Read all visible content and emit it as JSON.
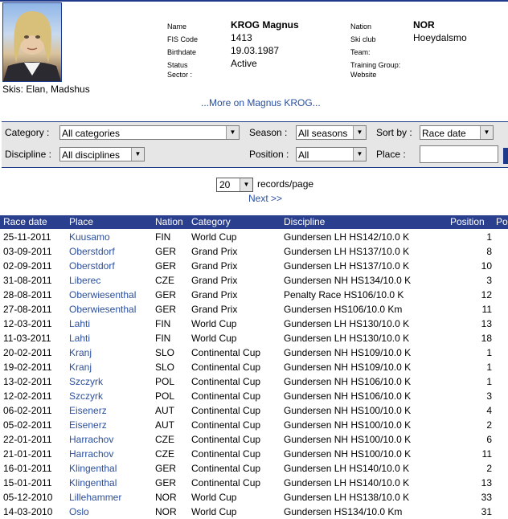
{
  "athlete": {
    "name_label": "Name",
    "name": "KROG Magnus",
    "fiscode_label": "FIS Code",
    "fiscode": "1413",
    "birthdate_label": "Birthdate",
    "birthdate": "19.03.1987",
    "status_label": "Status",
    "status": "Active",
    "sector_label": "Sector :",
    "nation_label": "Nation",
    "nation": "NOR",
    "skiclub_label": "Ski club",
    "skiclub": "Hoeydalsmo",
    "team_label": "Team:",
    "training_label": "Training Group:",
    "website_label": "Website",
    "skis": "Skis: Elan, Madshus",
    "more_link": "...More on Magnus KROG..."
  },
  "filters": {
    "category_label": "Category :",
    "category_value": "All categories",
    "discipline_label": "Discipline :",
    "discipline_value": "All disciplines",
    "season_label": "Season :",
    "season_value": "All seasons",
    "position_label": "Position :",
    "position_value": "All",
    "sortby_label": "Sort by :",
    "sortby_value": "Race date",
    "place_label": "Place :"
  },
  "paging": {
    "records_value": "20",
    "records_label": "records/page",
    "next": "Next >>"
  },
  "table": {
    "headers": [
      "Race date",
      "Place",
      "Nation",
      "Category",
      "Discipline",
      "Position",
      "Po"
    ],
    "rows": [
      {
        "date": "25-11-2011",
        "place": "Kuusamo",
        "nation": "FIN",
        "category": "World Cup",
        "discipline": "Gundersen LH HS142/10.0 K",
        "position": "1"
      },
      {
        "date": "03-09-2011",
        "place": "Oberstdorf",
        "nation": "GER",
        "category": "Grand Prix",
        "discipline": "Gundersen LH HS137/10.0 K",
        "position": "8"
      },
      {
        "date": "02-09-2011",
        "place": "Oberstdorf",
        "nation": "GER",
        "category": "Grand Prix",
        "discipline": "Gundersen LH HS137/10.0 K",
        "position": "10"
      },
      {
        "date": "31-08-2011",
        "place": "Liberec",
        "nation": "CZE",
        "category": "Grand Prix",
        "discipline": "Gundersen NH HS134/10.0 K",
        "position": "3"
      },
      {
        "date": "28-08-2011",
        "place": "Oberwiesenthal",
        "nation": "GER",
        "category": "Grand Prix",
        "discipline": "Penalty Race HS106/10.0 K",
        "position": "12"
      },
      {
        "date": "27-08-2011",
        "place": "Oberwiesenthal",
        "nation": "GER",
        "category": "Grand Prix",
        "discipline": "Gundersen HS106/10.0 Km",
        "position": "11"
      },
      {
        "date": "12-03-2011",
        "place": "Lahti",
        "nation": "FIN",
        "category": "World Cup",
        "discipline": "Gundersen LH HS130/10.0 K",
        "position": "13"
      },
      {
        "date": "11-03-2011",
        "place": "Lahti",
        "nation": "FIN",
        "category": "World Cup",
        "discipline": "Gundersen LH HS130/10.0 K",
        "position": "18"
      },
      {
        "date": "20-02-2011",
        "place": "Kranj",
        "nation": "SLO",
        "category": "Continental Cup",
        "discipline": "Gundersen NH HS109/10.0 K",
        "position": "1"
      },
      {
        "date": "19-02-2011",
        "place": "Kranj",
        "nation": "SLO",
        "category": "Continental Cup",
        "discipline": "Gundersen NH HS109/10.0 K",
        "position": "1"
      },
      {
        "date": "13-02-2011",
        "place": "Szczyrk",
        "nation": "POL",
        "category": "Continental Cup",
        "discipline": "Gundersen NH HS106/10.0 K",
        "position": "1"
      },
      {
        "date": "12-02-2011",
        "place": "Szczyrk",
        "nation": "POL",
        "category": "Continental Cup",
        "discipline": "Gundersen NH HS106/10.0 K",
        "position": "3"
      },
      {
        "date": "06-02-2011",
        "place": "Eisenerz",
        "nation": "AUT",
        "category": "Continental Cup",
        "discipline": "Gundersen NH HS100/10.0 K",
        "position": "4"
      },
      {
        "date": "05-02-2011",
        "place": "Eisenerz",
        "nation": "AUT",
        "category": "Continental Cup",
        "discipline": "Gundersen NH HS100/10.0 K",
        "position": "2"
      },
      {
        "date": "22-01-2011",
        "place": "Harrachov",
        "nation": "CZE",
        "category": "Continental Cup",
        "discipline": "Gundersen NH HS100/10.0 K",
        "position": "6"
      },
      {
        "date": "21-01-2011",
        "place": "Harrachov",
        "nation": "CZE",
        "category": "Continental Cup",
        "discipline": "Gundersen NH HS100/10.0 K",
        "position": "11"
      },
      {
        "date": "16-01-2011",
        "place": "Klingenthal",
        "nation": "GER",
        "category": "Continental Cup",
        "discipline": "Gundersen LH HS140/10.0 K",
        "position": "2"
      },
      {
        "date": "15-01-2011",
        "place": "Klingenthal",
        "nation": "GER",
        "category": "Continental Cup",
        "discipline": "Gundersen LH HS140/10.0 K",
        "position": "13"
      },
      {
        "date": "05-12-2010",
        "place": "Lillehammer",
        "nation": "NOR",
        "category": "World Cup",
        "discipline": "Gundersen LH HS138/10.0 K",
        "position": "33"
      },
      {
        "date": "14-03-2010",
        "place": "Oslo",
        "nation": "NOR",
        "category": "World Cup",
        "discipline": "Gundersen HS134/10.0 Km",
        "position": "31"
      }
    ]
  }
}
